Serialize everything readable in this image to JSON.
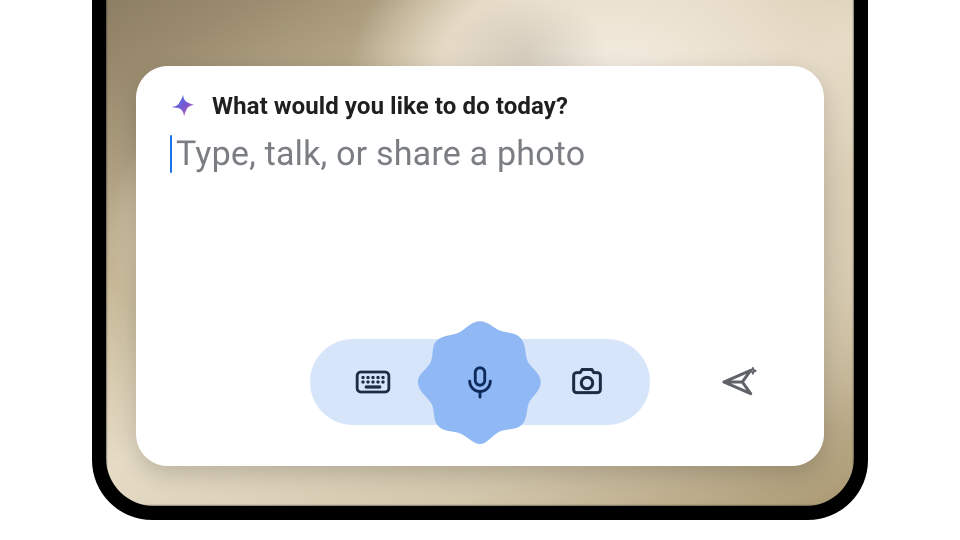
{
  "card": {
    "prompt": "What would you like to do today?",
    "placeholder": "Type, talk, or share a photo"
  },
  "icons": {
    "spark": "spark-icon",
    "keyboard": "keyboard-icon",
    "mic": "microphone-icon",
    "camera": "camera-icon",
    "send": "send-icon"
  },
  "colors": {
    "pill_bg": "#d7e5fb",
    "blob_bg": "#8fb8f4",
    "accent": "#1a73e8",
    "placeholder": "#7a7d82"
  }
}
